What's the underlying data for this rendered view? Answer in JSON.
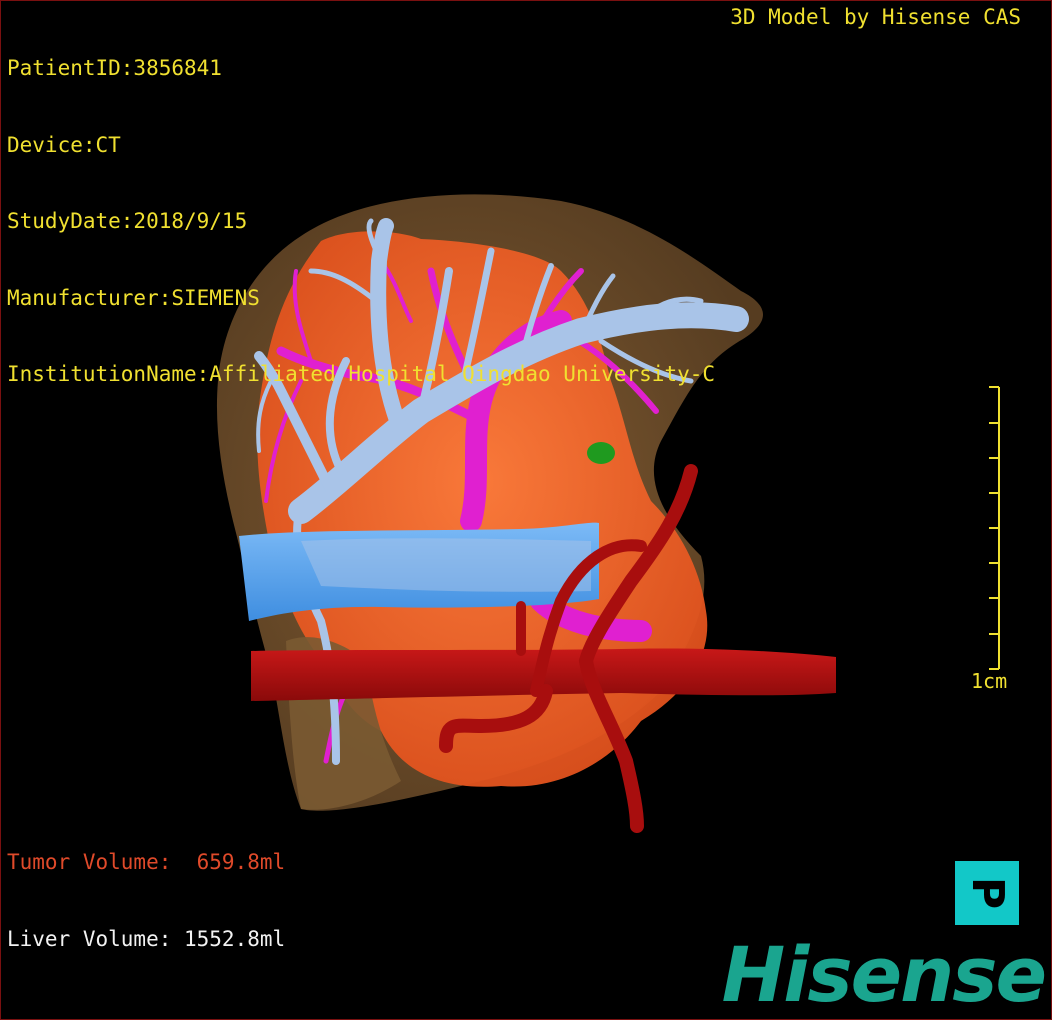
{
  "study": {
    "patient_id": "PatientID:3856841",
    "device": "Device:CT",
    "study_date": "StudyDate:2018/9/15",
    "manufacturer": "Manufacturer:SIEMENS",
    "institution": "InstitutionName:Affiliated Hospital Qingdao University-C"
  },
  "credit": "3D Model by Hisense CAS",
  "volumes": {
    "tumor": "Tumor Volume:  659.8ml",
    "liver": "Liver Volume: 1552.8ml"
  },
  "scale_bar": {
    "label": "1cm"
  },
  "orientation": {
    "label": "P"
  },
  "logo": "Hisense",
  "colors": {
    "overlay_text": "#f0e030",
    "tumor_text": "#e04a2a",
    "liver": "#7a5a32",
    "tumor": "#ff6a2a",
    "hepatic_vein": "#a9c4e8",
    "portal_vein": "#e020d0",
    "vena_cava": "#5fa8f0",
    "artery": "#b01010",
    "lesion": "#1f9a1f",
    "orientation_cube": "#12c8c8",
    "logo": "#1aa58f"
  }
}
